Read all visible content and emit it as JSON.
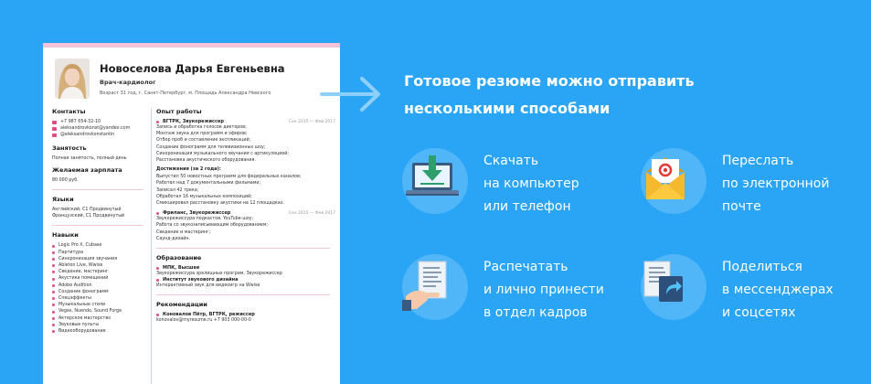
{
  "resume": {
    "name": "Новоселова Дарья Евгеньевна",
    "position": "Врач-кардиолог",
    "location": "Возраст 31 год, г. Санкт-Петербург, м. Площадь Александра Невского",
    "contacts_title": "Контакты",
    "contacts": [
      "+7 987 654-32-10",
      "aleksandrovkonst@yandex.com",
      "@aleksandrovkonstantin"
    ],
    "employment_title": "Занятость",
    "employment": "Полная занятость, полный день",
    "salary_title": "Желаемая зарплата",
    "salary": "80 000 руб.",
    "languages_title": "Языки",
    "languages": [
      "Английский, C1 Продвинутый",
      "Французский, C1 Продвинутый"
    ],
    "skills_title": "Навыки",
    "skills": [
      "Logic Pro X, Cubase",
      "Партитура",
      "Синхронизация звучания",
      "Ableton Live, Wwise",
      "Сведение, мастеринг",
      "Акустика помещений",
      "Adobe Audition",
      "Создание фонограмм",
      "Спецэффекты",
      "Музыкальные стили",
      "Vegas, Nuendo, Sound Forge",
      "Актерское мастерство",
      "Звуковые пульты",
      "Видеооборудование"
    ],
    "experience_title": "Опыт работы",
    "jobs": [
      {
        "title": "ВГТРК, Звукорежиссер",
        "dates": "Сен 2015 — Фев 2017",
        "duties": [
          "Запись и обработка голосов дикторов;",
          "Монтаж звука для программ и эфиров;",
          "Отбор проб и составление экспликаций;",
          "Создание фонограмм для телевизионных шоу;",
          "Синхронизация музыкального звучания с артикуляцией;",
          "Расстановка акустического оборудования."
        ],
        "achievements_title": "Достижения (за 2 года):",
        "achievements": [
          "Выпустил 50 новостных программ для федеральных каналов;",
          "Работал над 7 документальными фильмами;",
          "Записал 42 трека;",
          "Обработал 16 музыкальных композиций;",
          "Смикшировал расстановку акустики на 12 площадках."
        ]
      },
      {
        "title": "Фриланс, Звукорежиссер",
        "dates": "Сен 2015 — Фев 2017",
        "duties": [
          "Звукорежиссура подкастов, YouTube-шоу;",
          "Работа со звукозаписывающим оборудованием;",
          "Сведение и мастеринг;",
          "Саунд-дизайн."
        ]
      }
    ],
    "education_title": "Образование",
    "education": [
      {
        "school": "МПК, Высшее",
        "desc": "Звукорежиссура зрелищных програм, Звукорежиссер"
      },
      {
        "school": "Институт звукового дизайна",
        "desc": "Интерактивный звук для видеоигр на Wwise"
      }
    ],
    "recommendations_title": "Рекомендации",
    "recommendations": [
      {
        "who": "Коновалов Пётр, ВГТРК, режиссер",
        "contact": "konovalov@myresume.ru +7 903 000-00-0"
      }
    ]
  },
  "headline": [
    "Готовое резюме можно отправить",
    "несколькими способами"
  ],
  "features": [
    {
      "icon": "laptop-download-icon",
      "lines": [
        "Скачать",
        "на компьютер",
        "или телефон"
      ]
    },
    {
      "icon": "email-envelope-icon",
      "lines": [
        "Переслать",
        "по электронной",
        "почте"
      ]
    },
    {
      "icon": "print-document-icon",
      "lines": [
        "Распечатать",
        "и лично принести",
        "в отдел кадров"
      ]
    },
    {
      "icon": "share-document-icon",
      "lines": [
        "Поделиться",
        "в мессенджерах",
        "и соцсетях"
      ]
    }
  ],
  "colors": {
    "background": "#2aa4f4",
    "accent": "#e14b83",
    "resume_top": "#f3c4d8"
  }
}
